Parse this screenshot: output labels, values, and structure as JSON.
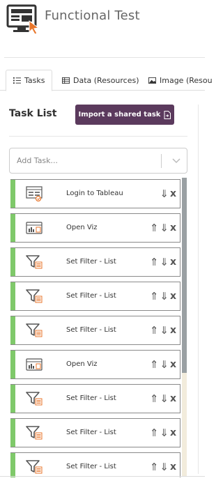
{
  "header": {
    "title": "Functional Test",
    "logo_icon": "monitor-cursor-icon"
  },
  "tabs": [
    {
      "label": "Tasks",
      "icon": "list-icon",
      "active": true
    },
    {
      "label": "Data (Resources)",
      "icon": "table-icon",
      "active": false
    },
    {
      "label": "Image (Resou",
      "icon": "image-icon",
      "active": false
    }
  ],
  "panel": {
    "title": "Task List",
    "import_label": "Import a shared task",
    "import_icon": "file-import-icon",
    "add_task_placeholder": "Add Task..."
  },
  "tasks": [
    {
      "label": "Login to Tableau",
      "icon": "login-form-icon",
      "up": false,
      "down": true
    },
    {
      "label": "Open Viz",
      "icon": "viz-window-icon",
      "up": true,
      "down": true
    },
    {
      "label": "Set Filter - List",
      "icon": "filter-list-icon",
      "up": true,
      "down": true
    },
    {
      "label": "Set Filter - List",
      "icon": "filter-list-icon",
      "up": true,
      "down": true
    },
    {
      "label": "Set Filter - List",
      "icon": "filter-list-icon",
      "up": true,
      "down": true
    },
    {
      "label": "Open Viz",
      "icon": "viz-window-icon",
      "up": true,
      "down": true
    },
    {
      "label": "Set Filter - List",
      "icon": "filter-list-icon",
      "up": true,
      "down": true
    },
    {
      "label": "Set Filter - List",
      "icon": "filter-list-icon",
      "up": true,
      "down": true
    },
    {
      "label": "Set Filter - List",
      "icon": "filter-list-icon",
      "up": true,
      "down": true
    }
  ],
  "colors": {
    "accent_button": "#5b3a5d",
    "task_stripe": "#7fc96a",
    "logo_orange": "#e8762b"
  }
}
